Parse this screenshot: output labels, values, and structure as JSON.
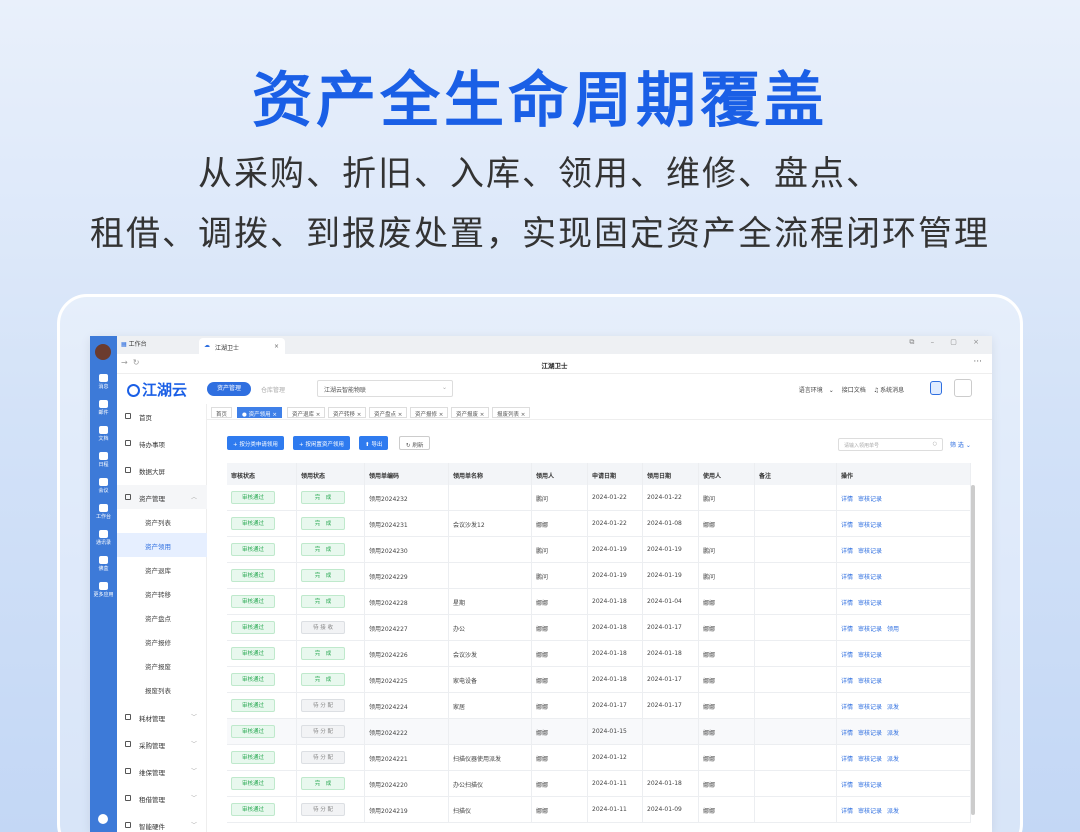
{
  "hero": {
    "title": "资产全生命周期覆盖",
    "line1": "从采购、折旧、入库、领用、维修、盘点、",
    "line2": "租借、调拨、到报废处置，实现固定资产全流程闭环管理"
  },
  "leftbar": {
    "items": [
      "消息",
      "邮件",
      "文档",
      "日程",
      "会议",
      "工作台",
      "通讯录",
      "佛盒",
      "更多应用"
    ]
  },
  "tabs": {
    "workbench": "工作台",
    "app": "江湖卫士"
  },
  "window": {
    "title": "江湖卫士"
  },
  "app": {
    "logo": "江湖云",
    "module": "资产管理",
    "module2": "仓库管理",
    "org": "江湖云智能物联",
    "lang": "语言环境",
    "api": "接口文档",
    "sys": "系统消息"
  },
  "menu": {
    "home": "首页",
    "todo": "待办事项",
    "screen": "数据大屏",
    "asset": "资产管理",
    "subs": [
      "资产列表",
      "资产领用",
      "资产退库",
      "资产转移",
      "资产盘点",
      "资产报修",
      "资产报废",
      "报废列表"
    ],
    "consumable": "耗材管理",
    "purchase": "采购管理",
    "maintain": "维保管理",
    "lease": "租借管理",
    "hardware": "智能硬件"
  },
  "crumbs": [
    "首页",
    "资产领用",
    "资产退库",
    "资产转移",
    "资产盘点",
    "资产报修",
    "资产报废",
    "报废列表"
  ],
  "toolbar": {
    "b1": "按分类申请领用",
    "b2": "按闲置资产领用",
    "b3": "导出",
    "b4": "刷新",
    "search": "请输入领用单号",
    "filter": "筛 选"
  },
  "table": {
    "headers": [
      "审核状态",
      "领用状态",
      "领用单编码",
      "领用单名称",
      "领用人",
      "申请日期",
      "领用日期",
      "使用人",
      "备注",
      "操作"
    ],
    "rows": [
      {
        "audit": "审核通过",
        "status": "完　成",
        "code": "领用2024232",
        "name": "",
        "user": "鹏问",
        "apply": "2024-01-22",
        "date": "2024-01-22",
        "holder": "鹏问",
        "ops": [
          "详情",
          "审核记录"
        ]
      },
      {
        "audit": "审核通过",
        "status": "完　成",
        "code": "领用2024231",
        "name": "会议沙发12",
        "user": "娜娜",
        "apply": "2024-01-22",
        "date": "2024-01-08",
        "holder": "娜娜",
        "ops": [
          "详情",
          "审核记录"
        ]
      },
      {
        "audit": "审核通过",
        "status": "完　成",
        "code": "领用2024230",
        "name": "",
        "user": "鹏问",
        "apply": "2024-01-19",
        "date": "2024-01-19",
        "holder": "鹏问",
        "ops": [
          "详情",
          "审核记录"
        ]
      },
      {
        "audit": "审核通过",
        "status": "完　成",
        "code": "领用2024229",
        "name": "",
        "user": "鹏问",
        "apply": "2024-01-19",
        "date": "2024-01-19",
        "holder": "鹏问",
        "ops": [
          "详情",
          "审核记录"
        ]
      },
      {
        "audit": "审核通过",
        "status": "完　成",
        "code": "领用2024228",
        "name": "星期",
        "user": "娜娜",
        "apply": "2024-01-18",
        "date": "2024-01-04",
        "holder": "娜娜",
        "ops": [
          "详情",
          "审核记录"
        ]
      },
      {
        "audit": "审核通过",
        "status": "待 接 收",
        "code": "领用2024227",
        "name": "办公",
        "user": "娜娜",
        "apply": "2024-01-18",
        "date": "2024-01-17",
        "holder": "娜娜",
        "ops": [
          "详情",
          "审核记录",
          "领用"
        ]
      },
      {
        "audit": "审核通过",
        "status": "完　成",
        "code": "领用2024226",
        "name": "会议沙发",
        "user": "娜娜",
        "apply": "2024-01-18",
        "date": "2024-01-18",
        "holder": "娜娜",
        "ops": [
          "详情",
          "审核记录"
        ]
      },
      {
        "audit": "审核通过",
        "status": "完　成",
        "code": "领用2024225",
        "name": "家电设备",
        "user": "娜娜",
        "apply": "2024-01-18",
        "date": "2024-01-17",
        "holder": "娜娜",
        "ops": [
          "详情",
          "审核记录"
        ]
      },
      {
        "audit": "审核通过",
        "status": "待 分 配",
        "code": "领用2024224",
        "name": "家居",
        "user": "娜娜",
        "apply": "2024-01-17",
        "date": "2024-01-17",
        "holder": "娜娜",
        "ops": [
          "详情",
          "审核记录",
          "派发"
        ]
      },
      {
        "audit": "审核通过",
        "status": "待 分 配",
        "code": "领用2024222",
        "name": "",
        "user": "娜娜",
        "apply": "2024-01-15",
        "date": "",
        "holder": "娜娜",
        "ops": [
          "详情",
          "审核记录",
          "派发"
        ]
      },
      {
        "audit": "审核通过",
        "status": "待 分 配",
        "code": "领用2024221",
        "name": "扫描仪器使用派发",
        "user": "娜娜",
        "apply": "2024-01-12",
        "date": "",
        "holder": "娜娜",
        "ops": [
          "详情",
          "审核记录",
          "派发"
        ]
      },
      {
        "audit": "审核通过",
        "status": "完　成",
        "code": "领用2024220",
        "name": "办公扫描仪",
        "user": "娜娜",
        "apply": "2024-01-11",
        "date": "2024-01-18",
        "holder": "娜娜",
        "ops": [
          "详情",
          "审核记录"
        ]
      },
      {
        "audit": "审核通过",
        "status": "待 分 配",
        "code": "领用2024219",
        "name": "扫描仪",
        "user": "娜娜",
        "apply": "2024-01-11",
        "date": "2024-01-09",
        "holder": "娜娜",
        "ops": [
          "详情",
          "审核记录",
          "派发"
        ]
      }
    ]
  }
}
